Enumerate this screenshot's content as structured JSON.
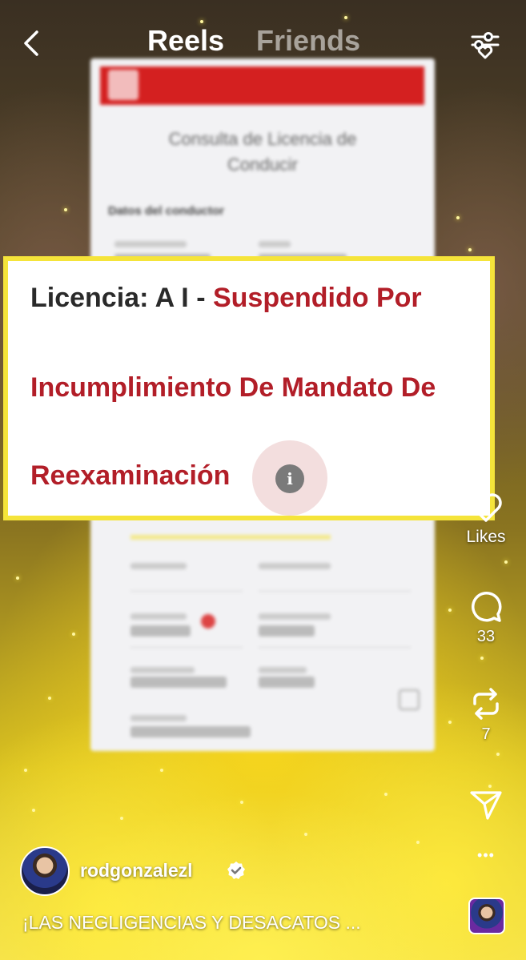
{
  "header": {
    "tab_reels": "Reels",
    "tab_friends": "Friends",
    "back_icon": "chevron-left-icon",
    "filter_icon": "sliders-heart-icon"
  },
  "card": {
    "line1_prefix": "Licencia: A I - ",
    "line1_status": "Suspendido Por",
    "line2": "Incumplimiento De Mandato De",
    "line3": "Reexaminación",
    "info_glyph": "i",
    "accent_color": "#b21e28",
    "border_color": "#f5e43a"
  },
  "document": {
    "title_line1": "Consulta de Licencia de",
    "title_line2": "Conducir",
    "section_label": "Datos del conductor"
  },
  "rail": {
    "likes_label": "Likes",
    "comments_count": "33",
    "reposts_count": "7",
    "more_glyph": "•••"
  },
  "footer": {
    "username": "rodgonzalezl",
    "caption": "¡LAS NEGLIGENCIAS Y DESACATOS ..."
  }
}
